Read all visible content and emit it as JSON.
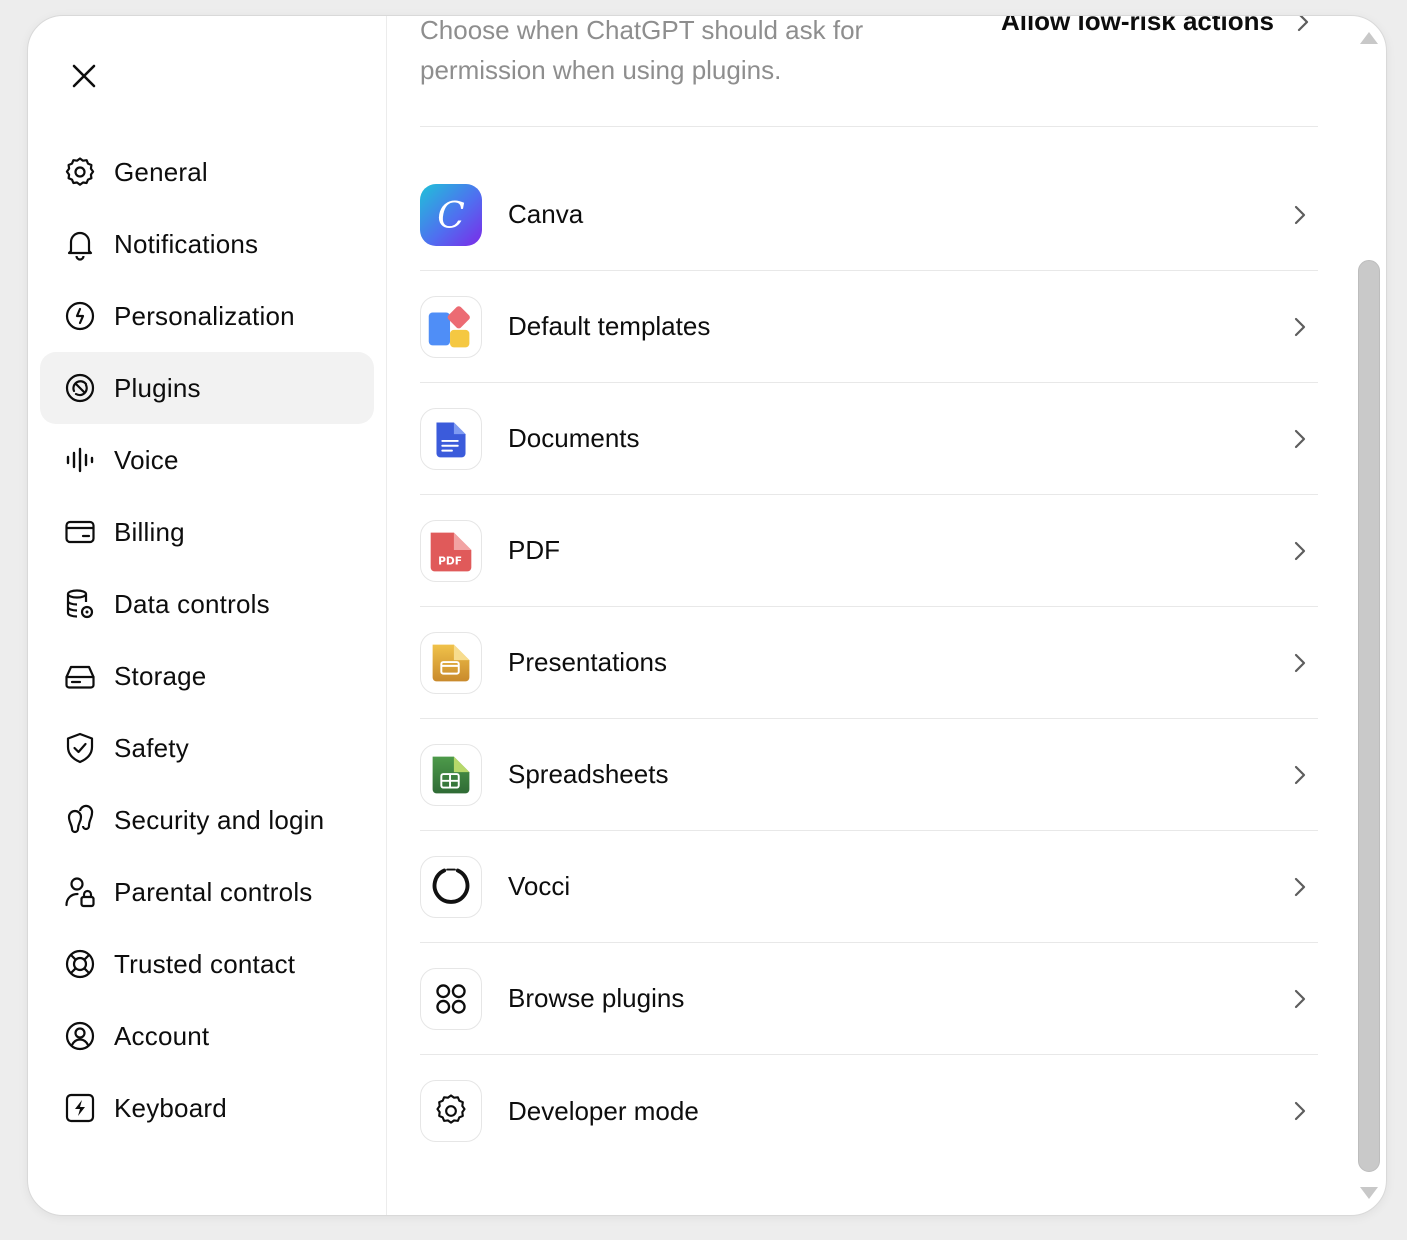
{
  "sidebar": {
    "close_label": "Close",
    "items": [
      {
        "label": "General",
        "icon": "gear-icon"
      },
      {
        "label": "Notifications",
        "icon": "bell-icon"
      },
      {
        "label": "Personalization",
        "icon": "personalization-icon"
      },
      {
        "label": "Plugins",
        "icon": "plugins-icon",
        "active": true
      },
      {
        "label": "Voice",
        "icon": "waveform-icon"
      },
      {
        "label": "Billing",
        "icon": "card-icon"
      },
      {
        "label": "Data controls",
        "icon": "database-gear-icon"
      },
      {
        "label": "Storage",
        "icon": "drive-icon"
      },
      {
        "label": "Safety",
        "icon": "shield-check-icon"
      },
      {
        "label": "Security and login",
        "icon": "security-icon"
      },
      {
        "label": "Parental controls",
        "icon": "person-lock-icon"
      },
      {
        "label": "Trusted contact",
        "icon": "lifebuoy-icon"
      },
      {
        "label": "Account",
        "icon": "user-circle-icon"
      },
      {
        "label": "Keyboard",
        "icon": "keyboard-bolt-icon"
      }
    ]
  },
  "permissions": {
    "description": "Choose when ChatGPT should ask for permission when using plugins.",
    "value": "Allow low-risk actions"
  },
  "plugins": [
    {
      "label": "Canva",
      "icon": "canva-icon"
    },
    {
      "label": "Default templates",
      "icon": "templates-icon"
    },
    {
      "label": "Documents",
      "icon": "documents-icon"
    },
    {
      "label": "PDF",
      "icon": "pdf-icon",
      "icon_text": "PDF"
    },
    {
      "label": "Presentations",
      "icon": "presentations-icon"
    },
    {
      "label": "Spreadsheets",
      "icon": "spreadsheets-icon"
    },
    {
      "label": "Vocci",
      "icon": "vocci-icon"
    },
    {
      "label": "Browse plugins",
      "icon": "grid-circles-icon"
    },
    {
      "label": "Developer mode",
      "icon": "gear-icon"
    }
  ],
  "colors": {
    "active_bg": "#f2f2f2",
    "text": "#0d0d0d",
    "muted": "#8e8e8e",
    "divider": "#e8e8e8"
  }
}
